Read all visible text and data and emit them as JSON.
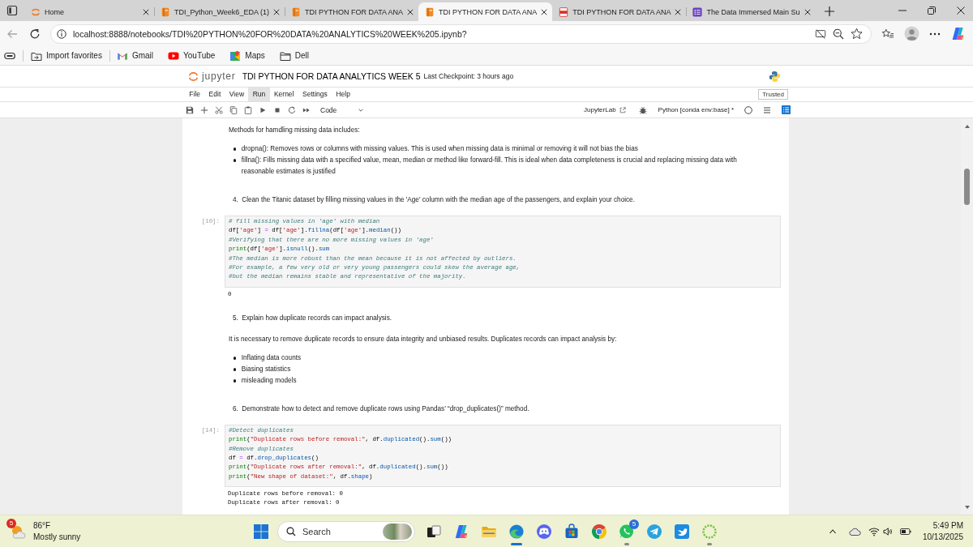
{
  "browser": {
    "tabs": [
      {
        "title": "Home",
        "kind": "ring",
        "selected": false
      },
      {
        "title": "TDI_Python_Week6_EDA (1)",
        "kind": "notebook",
        "selected": false
      },
      {
        "title": "TDI PYTHON FOR DATA ANA",
        "kind": "notebook",
        "selected": false
      },
      {
        "title": "TDI PYTHON FOR DATA ANA",
        "kind": "notebook",
        "selected": true
      },
      {
        "title": "TDI PYTHON FOR DATA ANA",
        "kind": "pdf",
        "selected": false
      },
      {
        "title": "The Data Immersed Main Su",
        "kind": "form",
        "selected": false
      }
    ],
    "url": "localhost:8888/notebooks/TDI%20PYTHON%20FOR%20DATA%20ANALYTICS%20WEEK%205.ipynb?",
    "bookmarks": [
      {
        "label": "Import favorites",
        "kind": "import"
      },
      {
        "label": "Gmail",
        "kind": "mail"
      },
      {
        "label": "YouTube",
        "kind": "video"
      },
      {
        "label": "Maps",
        "kind": "map"
      },
      {
        "label": "Dell",
        "kind": "folder"
      }
    ]
  },
  "notebook": {
    "logo": "jupyter",
    "title": "TDI PYTHON FOR DATA ANALYTICS WEEK 5",
    "checkpoint": "Last Checkpoint: 3 hours ago",
    "trusted": "Trusted",
    "menu": [
      {
        "label": "File",
        "selected": false
      },
      {
        "label": "Edit",
        "selected": false
      },
      {
        "label": "View",
        "selected": false
      },
      {
        "label": "Run",
        "selected": true
      },
      {
        "label": "Kernel",
        "selected": false
      },
      {
        "label": "Settings",
        "selected": false
      },
      {
        "label": "Help",
        "selected": false
      }
    ],
    "cell_type": "Code",
    "lab_link": "JupyterLab",
    "kernel": "Python [conda env:base] *",
    "cells": [
      {
        "kind": "paragraph",
        "text": "Methods for hamdling missing data includes:"
      },
      {
        "kind": "bullets",
        "items": [
          "dropna(): Removes rows or columns with missing values. This is used when missing data is minimal or removing it will not bias the bias",
          "fillna(): Fills missing data with a specified value, mean, median or method like forward-fill. This is ideal when data completeness is crucial and replacing missing data with reasonable estimates is justified"
        ]
      },
      {
        "kind": "numbered",
        "number": "4.",
        "text": "Clean the Titanic dataset by filling missing values in the 'Age' column with the median age of the passengers, and explain your choice."
      },
      {
        "kind": "code",
        "prompt": "[10]:",
        "lines": [
          [
            {
              "kind": "comment",
              "text": "# fill missing values in 'age' with median"
            }
          ],
          [
            {
              "kind": "plain",
              "text": "df["
            },
            {
              "kind": "string",
              "text": "'age'"
            },
            {
              "kind": "plain",
              "text": "] "
            },
            {
              "kind": "operator",
              "text": "="
            },
            {
              "kind": "plain",
              "text": " df["
            },
            {
              "kind": "string",
              "text": "'age'"
            },
            {
              "kind": "plain",
              "text": "]."
            },
            {
              "kind": "method",
              "text": "fillna"
            },
            {
              "kind": "plain",
              "text": "(df["
            },
            {
              "kind": "string",
              "text": "'age'"
            },
            {
              "kind": "plain",
              "text": "]."
            },
            {
              "kind": "method",
              "text": "median"
            },
            {
              "kind": "plain",
              "text": "())"
            }
          ],
          [
            {
              "kind": "comment",
              "text": "#Verifying that there are no more missing values in 'age'"
            }
          ],
          [
            {
              "kind": "builtin",
              "text": "print"
            },
            {
              "kind": "plain",
              "text": "(df["
            },
            {
              "kind": "string",
              "text": "'age'"
            },
            {
              "kind": "plain",
              "text": "]."
            },
            {
              "kind": "method",
              "text": "isnull"
            },
            {
              "kind": "plain",
              "text": "()."
            },
            {
              "kind": "method",
              "text": "sum"
            }
          ],
          [
            {
              "kind": "comment",
              "text": "#The median is more robust than the mean because it is not affected by outliers."
            }
          ],
          [
            {
              "kind": "comment",
              "text": "#For example, a few very old or very young passengers could skew the average age,"
            }
          ],
          [
            {
              "kind": "comment",
              "text": "#but the median remains stable and representative of the majority."
            }
          ]
        ]
      },
      {
        "kind": "output",
        "lines": [
          "0"
        ]
      },
      {
        "kind": "numbered",
        "number": "5.",
        "text": "Explain how duplicate records can impact analysis."
      },
      {
        "kind": "paragraph",
        "text": "It is necessary to remove duplicate records to ensure data integrity and unbiased results. Duplicates records can impact analysis by:"
      },
      {
        "kind": "bullets",
        "items": [
          "Inflating data counts",
          "Biasing statistics",
          "misleading models"
        ]
      },
      {
        "kind": "numbered",
        "number": "6.",
        "text": "Demonstrate how to detect and remove duplicate rows using Pandas’ “drop_duplicates()” method."
      },
      {
        "kind": "code",
        "prompt": "[14]:",
        "lines": [
          [
            {
              "kind": "comment",
              "text": "#Detect duplicates"
            }
          ],
          [
            {
              "kind": "builtin",
              "text": "print"
            },
            {
              "kind": "plain",
              "text": "("
            },
            {
              "kind": "string",
              "text": "\"Duplicate rows before removal:\""
            },
            {
              "kind": "plain",
              "text": ", df."
            },
            {
              "kind": "method",
              "text": "duplicated"
            },
            {
              "kind": "plain",
              "text": "()."
            },
            {
              "kind": "method",
              "text": "sum"
            },
            {
              "kind": "plain",
              "text": "())"
            }
          ],
          [
            {
              "kind": "comment",
              "text": "#Remove duplicates"
            }
          ],
          [
            {
              "kind": "plain",
              "text": "df "
            },
            {
              "kind": "operator",
              "text": "="
            },
            {
              "kind": "plain",
              "text": " df."
            },
            {
              "kind": "method",
              "text": "drop_duplicates"
            },
            {
              "kind": "plain",
              "text": "()"
            }
          ],
          [
            {
              "kind": "builtin",
              "text": "print"
            },
            {
              "kind": "plain",
              "text": "("
            },
            {
              "kind": "string",
              "text": "\"Duplicate rows after removal:\""
            },
            {
              "kind": "plain",
              "text": ", df."
            },
            {
              "kind": "method",
              "text": "duplicated"
            },
            {
              "kind": "plain",
              "text": "()."
            },
            {
              "kind": "method",
              "text": "sum"
            },
            {
              "kind": "plain",
              "text": "())"
            }
          ],
          [
            {
              "kind": "builtin",
              "text": "print"
            },
            {
              "kind": "plain",
              "text": "("
            },
            {
              "kind": "string",
              "text": "\"New shape of dataset:\""
            },
            {
              "kind": "plain",
              "text": ", df."
            },
            {
              "kind": "method",
              "text": "shape"
            },
            {
              "kind": "plain",
              "text": ")"
            }
          ]
        ]
      },
      {
        "kind": "output",
        "lines": [
          "Duplicate rows before removal: 0",
          "Duplicate rows after removal: 0"
        ]
      }
    ]
  },
  "taskbar": {
    "weather": {
      "badge": "5",
      "temperature": "86°F",
      "condition": "Mostly sunny"
    },
    "search": {
      "placeholder": "Search"
    },
    "apps": [
      {
        "kind": "squares",
        "running": false,
        "selected": false
      },
      {
        "kind": "ribbon",
        "running": false,
        "selected": false
      },
      {
        "kind": "folder",
        "running": false,
        "selected": false
      },
      {
        "kind": "swirl",
        "running": true,
        "selected": true
      },
      {
        "kind": "gamepad",
        "running": false,
        "selected": false
      },
      {
        "kind": "bag",
        "running": false,
        "selected": false
      },
      {
        "kind": "wheel",
        "running": false,
        "selected": false
      },
      {
        "kind": "phone",
        "running": true,
        "selected": false,
        "badge": "5"
      },
      {
        "kind": "plane",
        "running": false,
        "selected": false
      },
      {
        "kind": "bird",
        "running": false,
        "selected": false
      },
      {
        "kind": "ring",
        "running": true,
        "selected": false
      }
    ],
    "clock": {
      "time": "5:49 PM",
      "date": "10/13/2025"
    }
  }
}
